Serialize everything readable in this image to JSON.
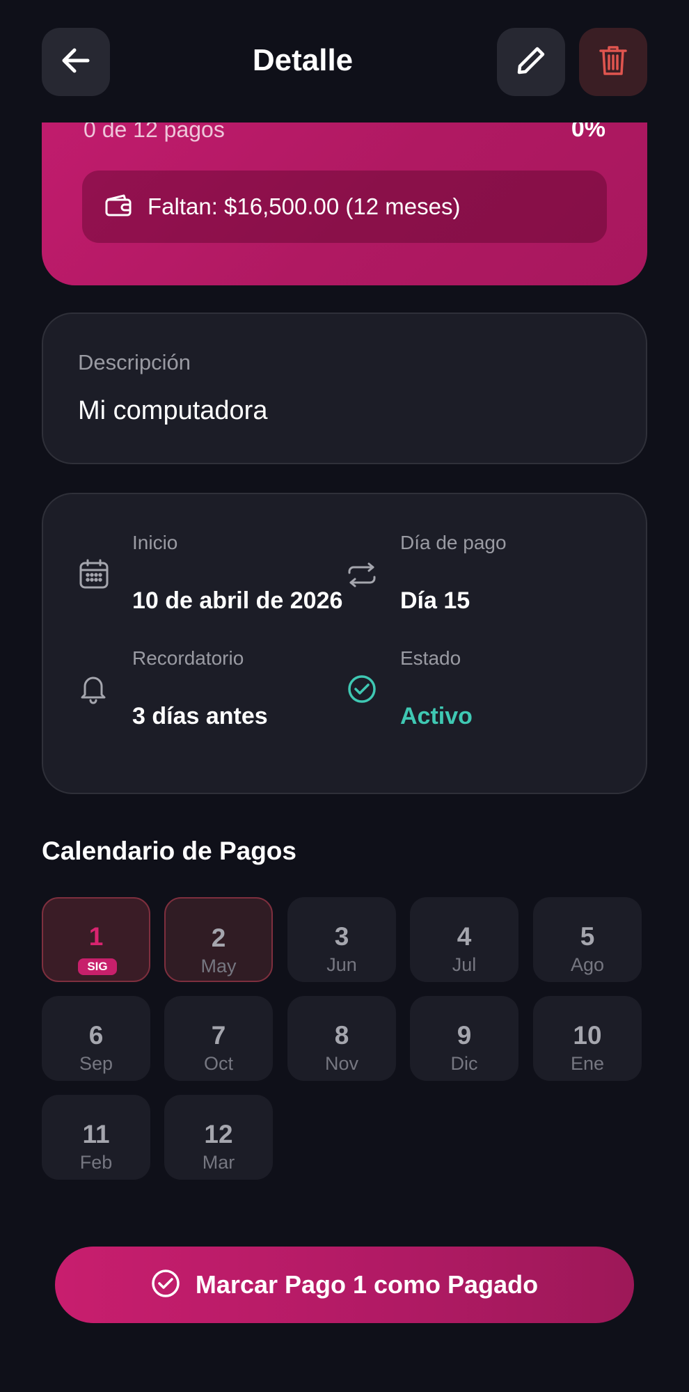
{
  "header": {
    "title": "Detalle",
    "back_icon": "arrow-left-icon",
    "edit_icon": "pencil-icon",
    "delete_icon": "trash-icon",
    "delete_color": "#e0554f"
  },
  "summary": {
    "payments_count": "0 de 12 pagos",
    "progress_percent": "0%",
    "remaining_text": "Faltan: $16,500.00 (12 meses)",
    "remaining_icon": "wallet-icon",
    "accent_color": "#c21c6e"
  },
  "description": {
    "label": "Descripción",
    "value": "Mi computadora"
  },
  "info": {
    "start_label": "Inicio",
    "start_value": "10 de abril de 2026",
    "start_icon": "calendar-icon",
    "payday_label": "Día de pago",
    "payday_value": "Día 15",
    "payday_icon": "repeat-icon",
    "reminder_label": "Recordatorio",
    "reminder_value": "3 días antes",
    "reminder_icon": "bell-icon",
    "status_label": "Estado",
    "status_value": "Activo",
    "status_icon": "check-circle-icon",
    "status_color": "#3fc8b3"
  },
  "calendar": {
    "title": "Calendario de Pagos",
    "next_badge": "SIG",
    "cells": [
      {
        "num": "1",
        "sub": ""
      },
      {
        "num": "2",
        "sub": "May"
      },
      {
        "num": "3",
        "sub": "Jun"
      },
      {
        "num": "4",
        "sub": "Jul"
      },
      {
        "num": "5",
        "sub": "Ago"
      },
      {
        "num": "6",
        "sub": "Sep"
      },
      {
        "num": "7",
        "sub": "Oct"
      },
      {
        "num": "8",
        "sub": "Nov"
      },
      {
        "num": "9",
        "sub": "Dic"
      },
      {
        "num": "10",
        "sub": "Ene"
      },
      {
        "num": "11",
        "sub": "Feb"
      },
      {
        "num": "12",
        "sub": "Mar"
      }
    ]
  },
  "action": {
    "label": "Marcar Pago 1 como Pagado",
    "icon": "check-circle-icon"
  }
}
